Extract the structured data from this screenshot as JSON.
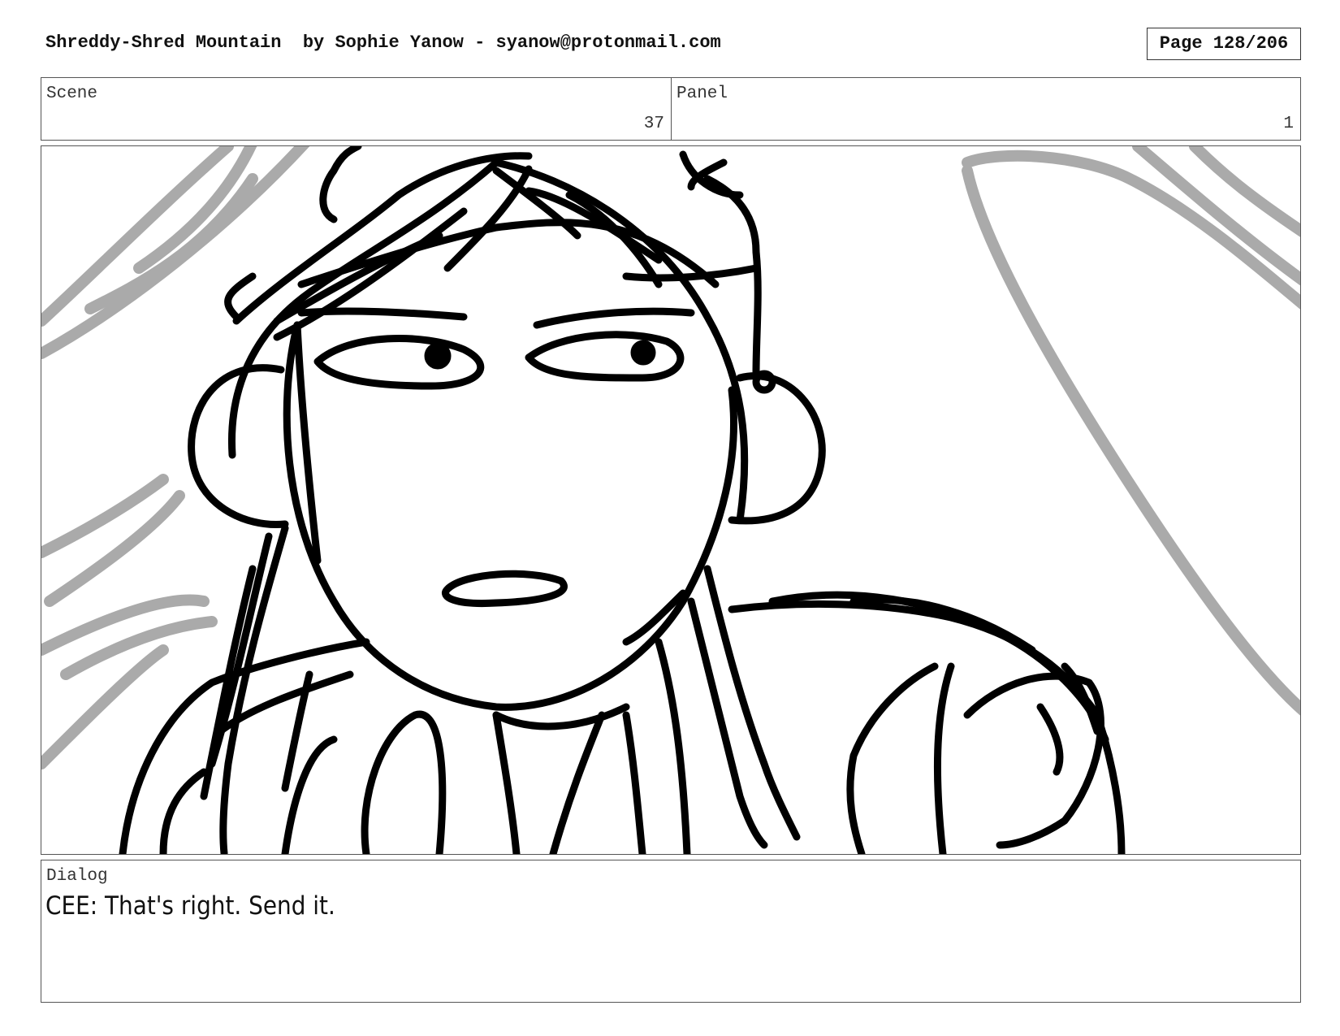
{
  "header": {
    "title": "Shreddy-Shred Mountain  by Sophie Yanow - syanow@protonmail.com",
    "page": "Page 128/206"
  },
  "scene": {
    "label": "Scene",
    "value": "37"
  },
  "panel": {
    "label": "Panel",
    "value": "1"
  },
  "dialog": {
    "label": "Dialog",
    "text": "CEE: That's right. Send it."
  },
  "colors": {
    "ink": "#000000",
    "background_strokes": "#aaaaaa",
    "border": "#555555"
  }
}
